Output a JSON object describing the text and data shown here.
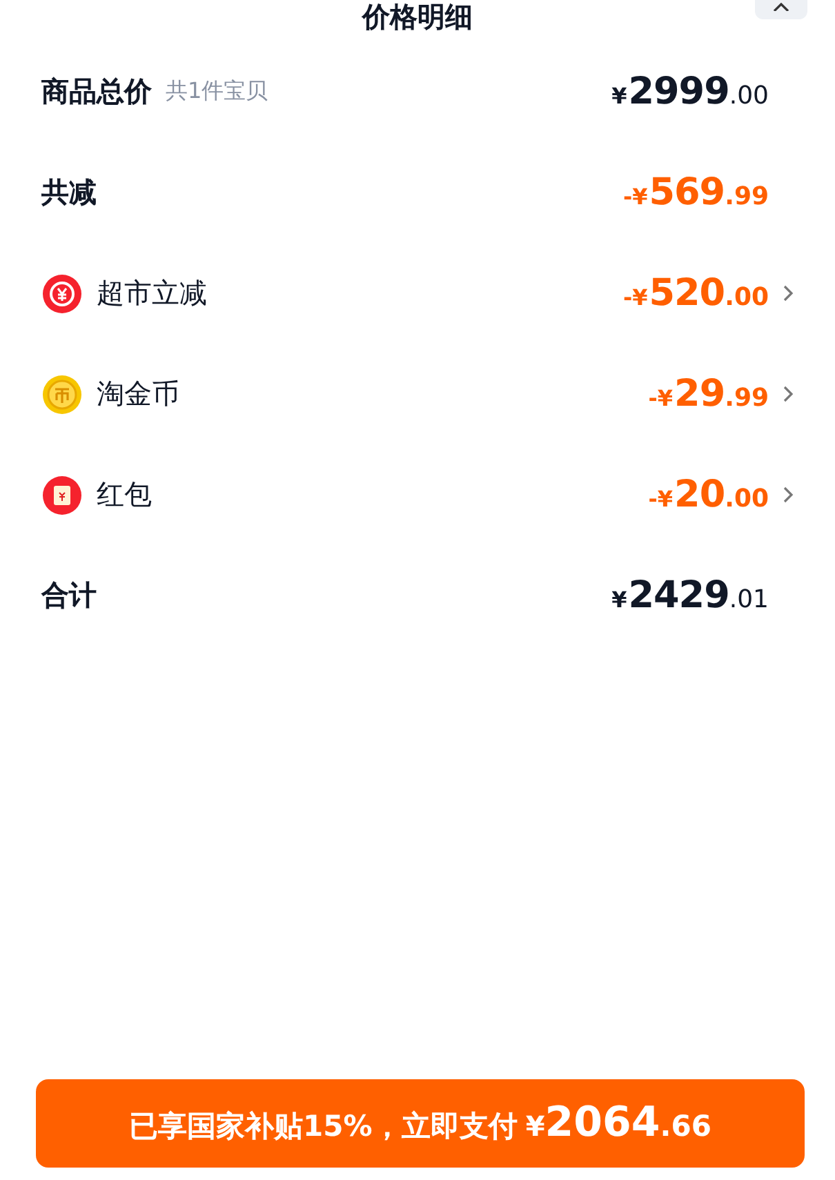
{
  "header": {
    "title": "价格明细"
  },
  "rows": [
    {
      "kind": "total",
      "label": "商品总价",
      "note": "共1件宝贝",
      "price": {
        "currency": "¥",
        "integer": "2999",
        "decimals": ".00"
      }
    },
    {
      "kind": "discount",
      "label": "共减",
      "price": {
        "sign": "-",
        "currency": "¥",
        "integer": "569",
        "decimals": ".99"
      }
    },
    {
      "kind": "item",
      "label": "超市立减",
      "price": {
        "sign": "-",
        "currency": "¥",
        "integer": "520",
        "decimals": ".00"
      }
    },
    {
      "kind": "item",
      "label": "淘金币",
      "price": {
        "sign": "-",
        "currency": "¥",
        "integer": "29",
        "decimals": ".99"
      }
    },
    {
      "kind": "item",
      "label": "红包",
      "price": {
        "sign": "-",
        "currency": "¥",
        "integer": "20",
        "decimals": ".00"
      }
    },
    {
      "kind": "total",
      "label": "合计",
      "price": {
        "currency": "¥",
        "integer": "2429",
        "decimals": ".01"
      }
    }
  ],
  "pay_button": {
    "label": "已享国家补贴15%，立即支付",
    "currency": "¥",
    "integer": "2064",
    "decimals": ".66"
  }
}
